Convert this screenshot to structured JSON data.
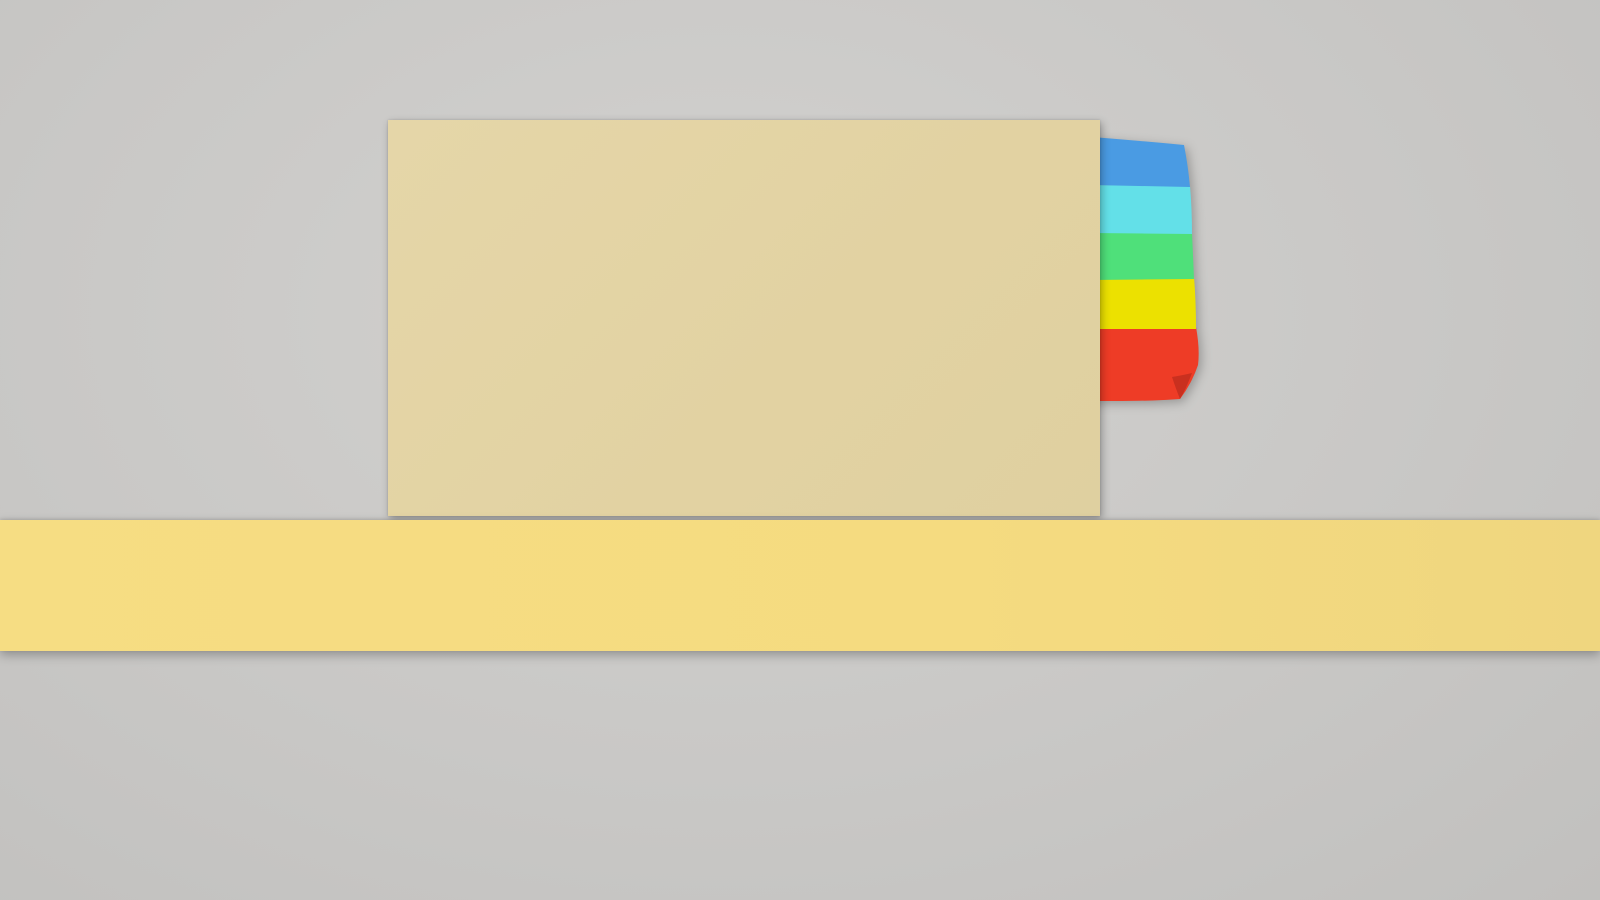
{
  "scene": {
    "colors": {
      "background": "#c9c8c6",
      "card": "#e2d2a2",
      "shelf": "#f5db80"
    }
  },
  "tabs": [
    {
      "name": "blue-tab",
      "color": "#4a9be3"
    },
    {
      "name": "cyan-tab",
      "color": "#63e0e8"
    },
    {
      "name": "green-tab",
      "color": "#4fe07a"
    },
    {
      "name": "yellow-tab",
      "color": "#ece100"
    },
    {
      "name": "red-tab",
      "color": "#ee3c26"
    }
  ]
}
